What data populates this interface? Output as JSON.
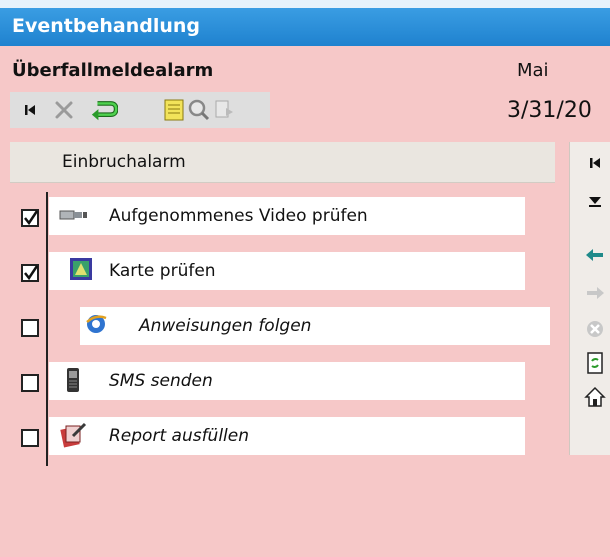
{
  "window": {
    "title": "Eventbehandlung"
  },
  "alarm": {
    "name": "Überfallmeldealarm",
    "month": "Mai",
    "date": "3/31/20"
  },
  "toolbar": {
    "icons": [
      "first-icon",
      "delete-icon",
      "undo-icon",
      "notes-icon",
      "search-icon",
      "forward-icon"
    ]
  },
  "task_list": {
    "header": "Einbruchalarm",
    "items": [
      {
        "label": "Aufgenommenes Video prüfen",
        "checked": true,
        "icon": "video-camera-icon"
      },
      {
        "label": "Karte prüfen",
        "checked": true,
        "icon": "map-icon"
      },
      {
        "label": "Anweisungen folgen",
        "checked": false,
        "icon": "internet-explorer-icon"
      },
      {
        "label": "SMS senden",
        "checked": false,
        "icon": "mobile-phone-icon"
      },
      {
        "label": "Report ausfüllen",
        "checked": false,
        "icon": "report-icon"
      }
    ]
  },
  "sidebar": {
    "icons": [
      "first-icon",
      "collapse-icon",
      "back-icon",
      "forward-icon",
      "cancel-icon",
      "refresh-icon",
      "home-icon"
    ]
  },
  "colors": {
    "background": "#f6c8c8",
    "titlebar": "#2b8fda",
    "accent_green": "#2a9a2a"
  }
}
